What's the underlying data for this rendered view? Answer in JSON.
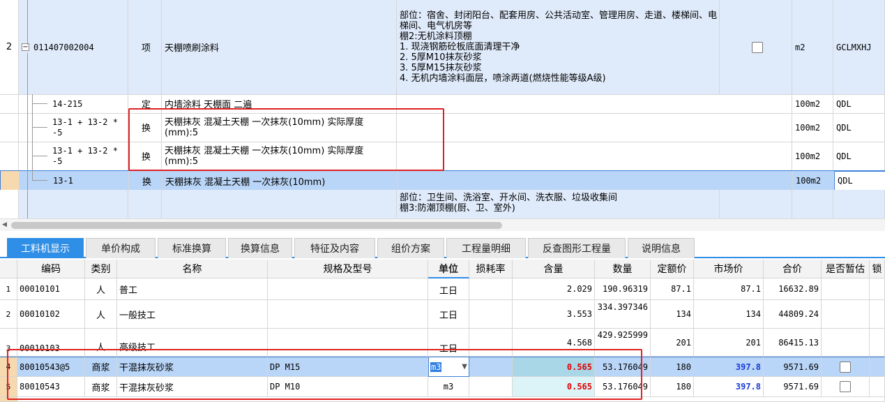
{
  "top_rows": [
    {
      "num": "2",
      "code": "011407002004",
      "type": "项",
      "name": "天棚喷刷涂料",
      "feature": "部位：宿舍、封闭阳台、配套用房、公共活动室、管理用房、走道、楼梯间、电梯间、电气机房等\n棚2:无机涂料顶棚\n1. 现浇钢筋砼板底面清理干净\n2. 5厚M10抹灰砂浆\n3. 5厚M15抹灰砂浆\n4. 无机内墙涂料面层，喷涂两道(燃烧性能等级A级)",
      "unit": "m2",
      "extra": "GCLMXHJ"
    },
    {
      "code": "14-215",
      "type": "定",
      "name": "内墙涂料 天棚面 二遍",
      "unit": "100m2",
      "extra": "QDL"
    },
    {
      "code": "13-1 + 13-2 * -5",
      "type": "换",
      "name": "天棚抹灰 混凝土天棚 一次抹灰(10mm)  实际厚度(mm):5",
      "unit": "100m2",
      "extra": "QDL"
    },
    {
      "code": "13-1 + 13-2 * -5",
      "type": "换",
      "name": "天棚抹灰 混凝土天棚 一次抹灰(10mm)  实际厚度(mm):5",
      "unit": "100m2",
      "extra": "QDL"
    },
    {
      "code": "13-1",
      "type": "换",
      "name": "天棚抹灰 混凝土天棚 一次抹灰(10mm)",
      "unit": "100m2",
      "extra": "QDL"
    },
    {
      "feature": "部位：卫生间、洗浴室、开水间、洗衣服、垃圾收集间\n棚3:防潮顶棚(厨、卫、室外)"
    }
  ],
  "tabs": [
    "工料机显示",
    "单价构成",
    "标准换算",
    "换算信息",
    "特征及内容",
    "组价方案",
    "工程量明细",
    "反查图形工程量",
    "说明信息"
  ],
  "headers": [
    "编码",
    "类别",
    "名称",
    "规格及型号",
    "单位",
    "损耗率",
    "含量",
    "数量",
    "定额价",
    "市场价",
    "合价",
    "是否暂估",
    "锁"
  ],
  "rows": [
    {
      "num": "1",
      "code": "00010101",
      "cat": "人",
      "name": "普工",
      "spec": "",
      "unit": "工日",
      "content": "2.029",
      "qty": "190.96319",
      "fixed": "87.1",
      "market": "87.1",
      "total": "16632.89"
    },
    {
      "num": "2",
      "code": "00010102",
      "cat": "人",
      "name": "一般技工",
      "spec": "",
      "unit": "工日",
      "content": "3.553",
      "qty": "334.397346",
      "fixed": "134",
      "market": "134",
      "total": "44809.24"
    },
    {
      "num": "3",
      "code": "00010103",
      "cat": "人",
      "name": "高级技工",
      "spec": "",
      "unit": "工日",
      "content": "4.568",
      "qty": "429.925999",
      "fixed": "201",
      "market": "201",
      "total": "86415.13"
    },
    {
      "num": "4",
      "code": "80010543@5",
      "cat": "商浆",
      "name": "干混抹灰砂浆",
      "spec": "DP M15",
      "unit": "m3",
      "content": "0.565",
      "qty": "53.176049",
      "fixed": "180",
      "market": "397.8",
      "total": "9571.69"
    },
    {
      "num": "5",
      "code": "80010543",
      "cat": "商浆",
      "name": "干混抹灰砂浆",
      "spec": "DP M10",
      "unit": "m3",
      "content": "0.565",
      "qty": "53.176049",
      "fixed": "180",
      "market": "397.8",
      "total": "9571.69"
    }
  ]
}
